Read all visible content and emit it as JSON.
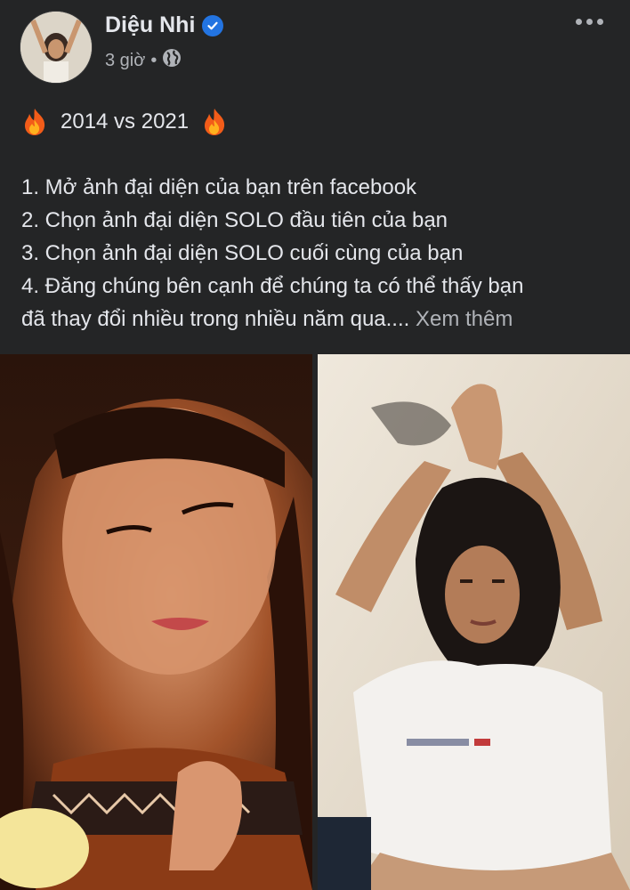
{
  "post": {
    "author": "Diệu Nhi",
    "time": "3 giờ",
    "separator": "•",
    "title": "2014 vs 2021",
    "lines": [
      "1. Mở ảnh đại diện của bạn trên facebook",
      "2. Chọn ảnh đại diện SOLO đầu tiên của bạn",
      "3. Chọn ảnh đại diện SOLO cuối cùng của bạn",
      "4. Đăng chúng bên cạnh để chúng ta có thể thấy bạn",
      "đã thay đổi nhiều trong nhiều năm qua...."
    ],
    "see_more": "Xem thêm"
  },
  "icons": {
    "verified": "verified-badge-icon",
    "audience": "globe-icon",
    "menu": "more-options-icon",
    "emoji": "fire-emoji-icon"
  },
  "colors": {
    "background": "#242526",
    "text": "#e4e6eb",
    "secondary": "#b0b3b8",
    "verified": "#2374e1"
  }
}
